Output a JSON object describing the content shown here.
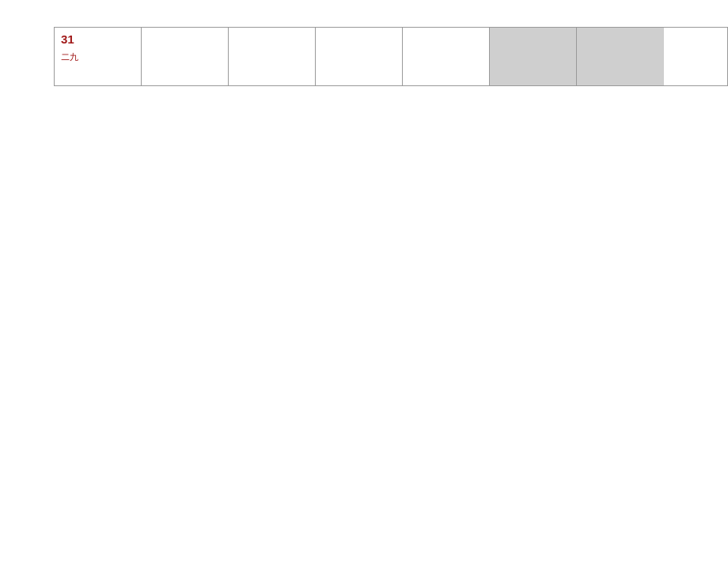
{
  "calendar": {
    "row": [
      {
        "number": "31",
        "lunar": "二九",
        "out_of_month": false
      },
      {
        "number": "",
        "lunar": "",
        "out_of_month": false
      },
      {
        "number": "",
        "lunar": "",
        "out_of_month": false
      },
      {
        "number": "",
        "lunar": "",
        "out_of_month": false
      },
      {
        "number": "",
        "lunar": "",
        "out_of_month": false
      },
      {
        "number": "",
        "lunar": "",
        "out_of_month": true
      },
      {
        "number": "",
        "lunar": "",
        "out_of_month": true
      }
    ]
  }
}
